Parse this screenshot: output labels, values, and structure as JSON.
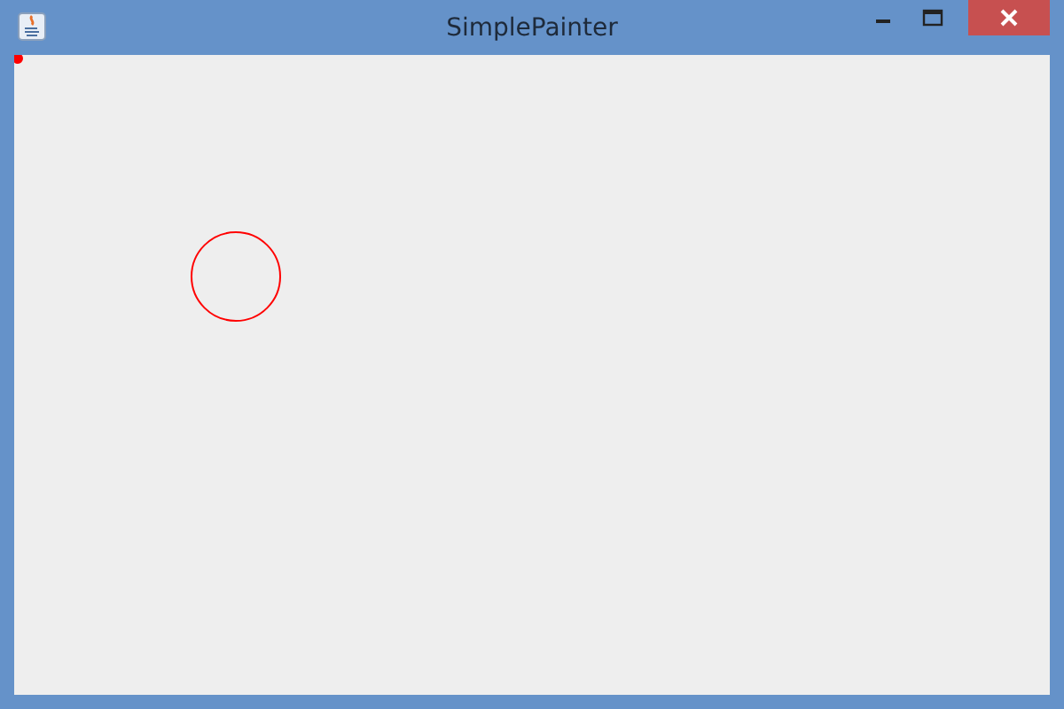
{
  "window": {
    "title": "SimplePainter"
  }
}
